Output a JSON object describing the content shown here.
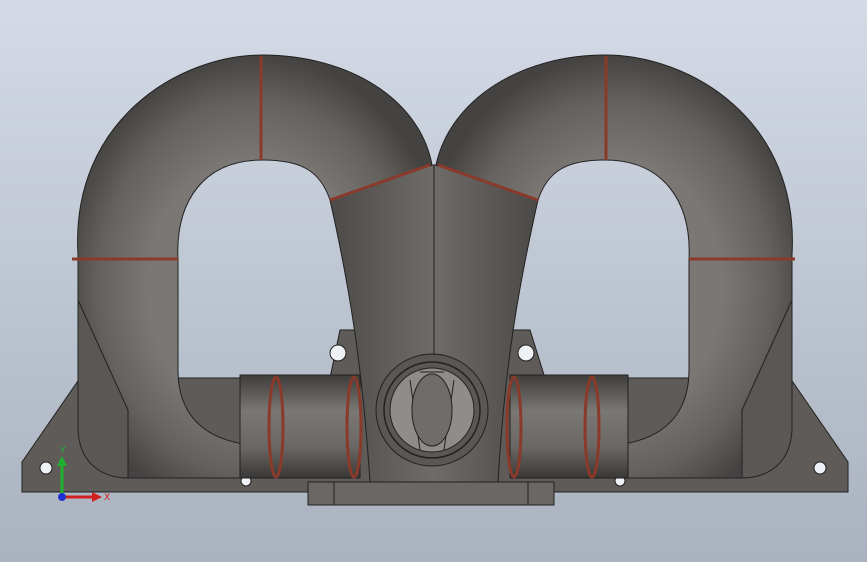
{
  "viewport": {
    "triad": {
      "x_label": "X",
      "y_label": "Y",
      "x_color": "#d02020",
      "y_color": "#20b030",
      "z_color": "#2030d0"
    }
  },
  "model": {
    "name": "",
    "pipe_color": "#6b6866",
    "weld_color": "#8a3a2a",
    "flange_color": "#5e5b59"
  }
}
